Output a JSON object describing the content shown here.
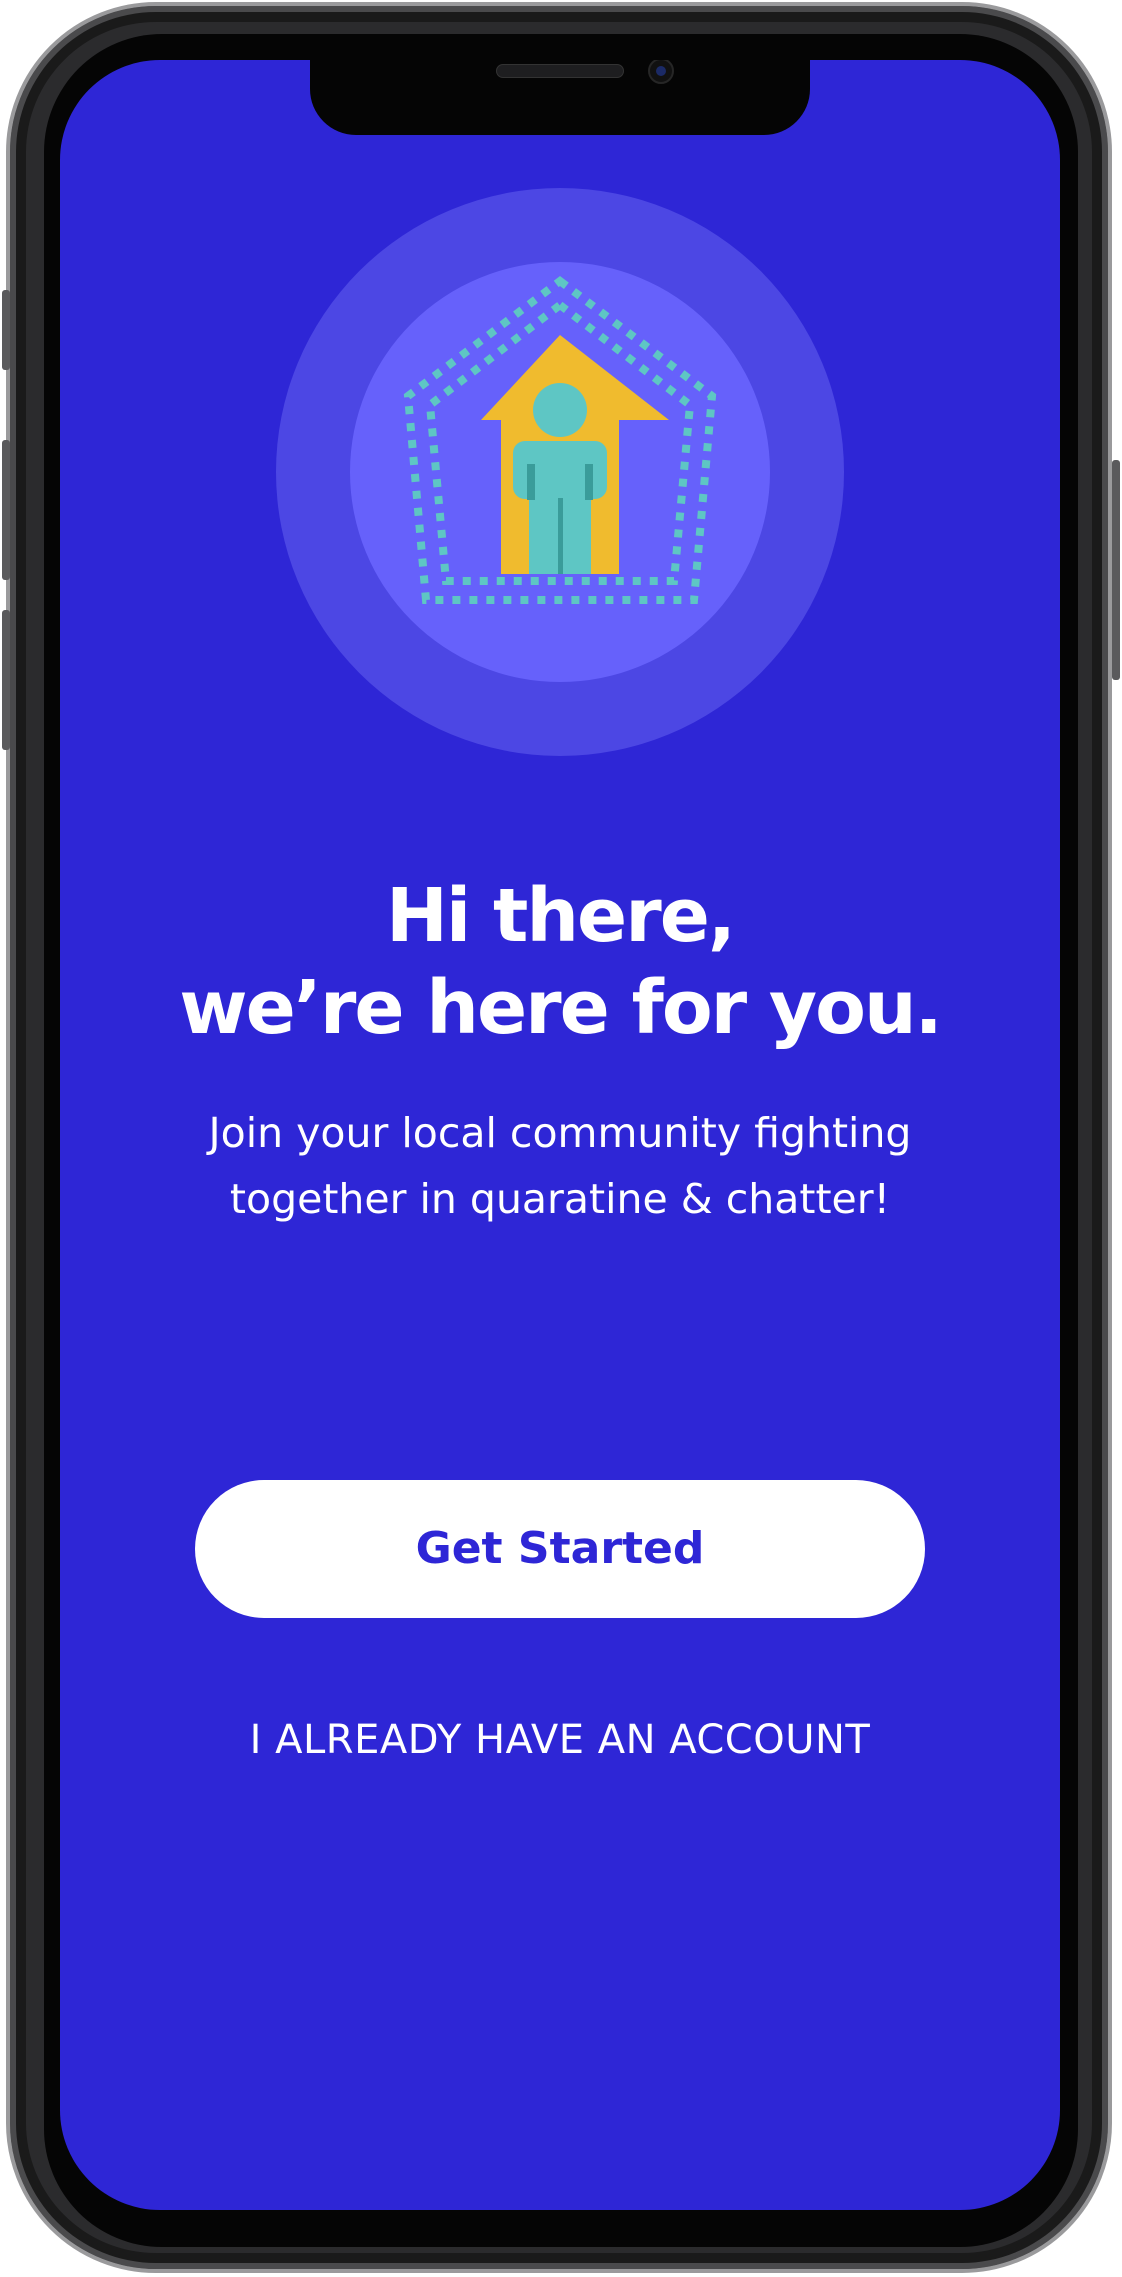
{
  "colors": {
    "background": "#2e26d6",
    "outer_ring": "#4c47e4",
    "inner_ring": "#6661fb",
    "house": "#f0bb2e",
    "person": "#5ec6c4",
    "dots": "#5ec6c4",
    "button_bg": "#ffffff",
    "button_text": "#2e26d6"
  },
  "illustration": {
    "icon": "house-person-icon",
    "ring_icon": "dotted-pentagon-icon"
  },
  "welcome": {
    "title_line1": "Hi there,",
    "title_line2": "we’re here for you.",
    "subtitle_line1": "Join your local community fighting",
    "subtitle_line2": "together in quaratine & chatter!"
  },
  "actions": {
    "get_started_label": "Get Started",
    "login_label": "I ALREADY HAVE AN ACCOUNT"
  }
}
